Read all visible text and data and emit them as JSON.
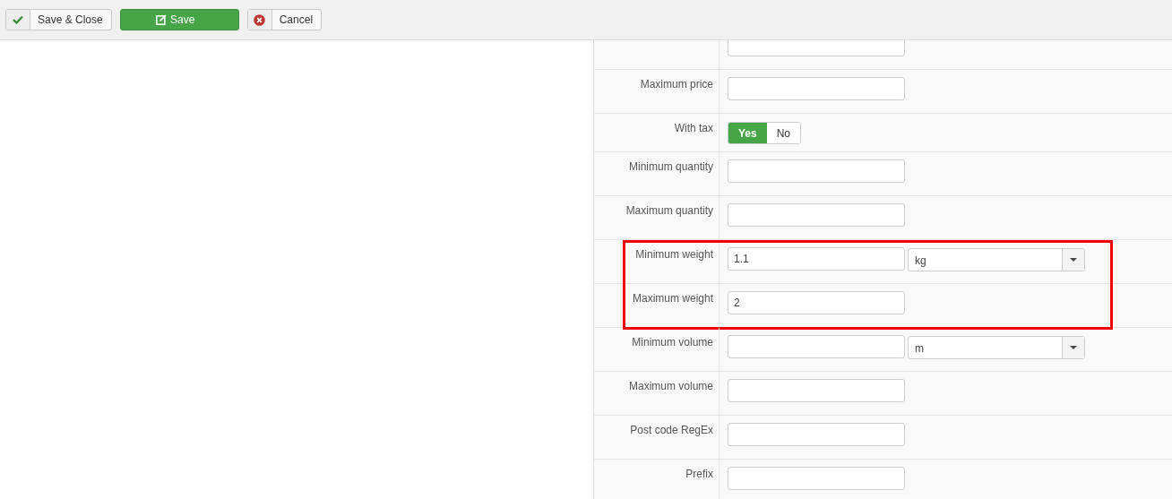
{
  "toolbar": [
    {
      "label": "Save & Close",
      "kind": "close",
      "primary": false
    },
    {
      "label": "Save",
      "kind": "save",
      "primary": true
    },
    {
      "label": "Cancel",
      "kind": "cancel",
      "primary": false
    }
  ],
  "form": {
    "rows": [
      {
        "kind": "text",
        "value": "",
        "highlighted": false
      },
      {
        "kind": "text",
        "label": "Maximum price",
        "value": "",
        "highlighted": false
      },
      {
        "kind": "toggle",
        "label": "With tax",
        "options": [
          {
            "label": "Yes",
            "selected": true
          },
          {
            "label": "No",
            "selected": false
          }
        ],
        "highlighted": false
      },
      {
        "kind": "text",
        "label": "Minimum quantity",
        "value": "",
        "highlighted": false
      },
      {
        "kind": "text",
        "label": "Maximum quantity",
        "value": "",
        "highlighted": false
      },
      {
        "kind": "unit",
        "label": "Minimum weight",
        "value": "1.1",
        "unit": "kg",
        "highlighted": true
      },
      {
        "kind": "text",
        "label": "Maximum weight",
        "value": "2",
        "highlighted": true
      },
      {
        "kind": "unit",
        "label": "Minimum volume",
        "value": "",
        "unit": "m",
        "highlighted": false
      },
      {
        "kind": "text",
        "label": "Maximum volume",
        "value": "",
        "highlighted": false
      },
      {
        "kind": "text",
        "label": "Post code RegEx",
        "value": "",
        "highlighted": false
      },
      {
        "kind": "text",
        "label": "Prefix",
        "value": "",
        "highlighted": false
      }
    ]
  }
}
